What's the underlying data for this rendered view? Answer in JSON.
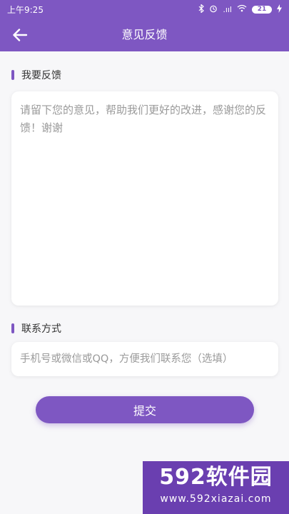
{
  "status_bar": {
    "time": "上午9:25",
    "signal_text": ".ııl",
    "battery_level": "21"
  },
  "app_bar": {
    "title": "意见反馈",
    "back_icon": "arrow-left-icon"
  },
  "feedback_section": {
    "label": "我要反馈",
    "placeholder": "请留下您的意见，帮助我们更好的改进，感谢您的反馈！谢谢",
    "value": ""
  },
  "contact_section": {
    "label": "联系方式",
    "placeholder": "手机号或微信或QQ，方便我们联系您（选填）",
    "value": ""
  },
  "submit_label": "提交",
  "watermark": {
    "brand": "592软件园",
    "url": "www.592xiazai.com"
  },
  "colors": {
    "accent": "#7e57c2",
    "background": "#f7f7f9"
  }
}
